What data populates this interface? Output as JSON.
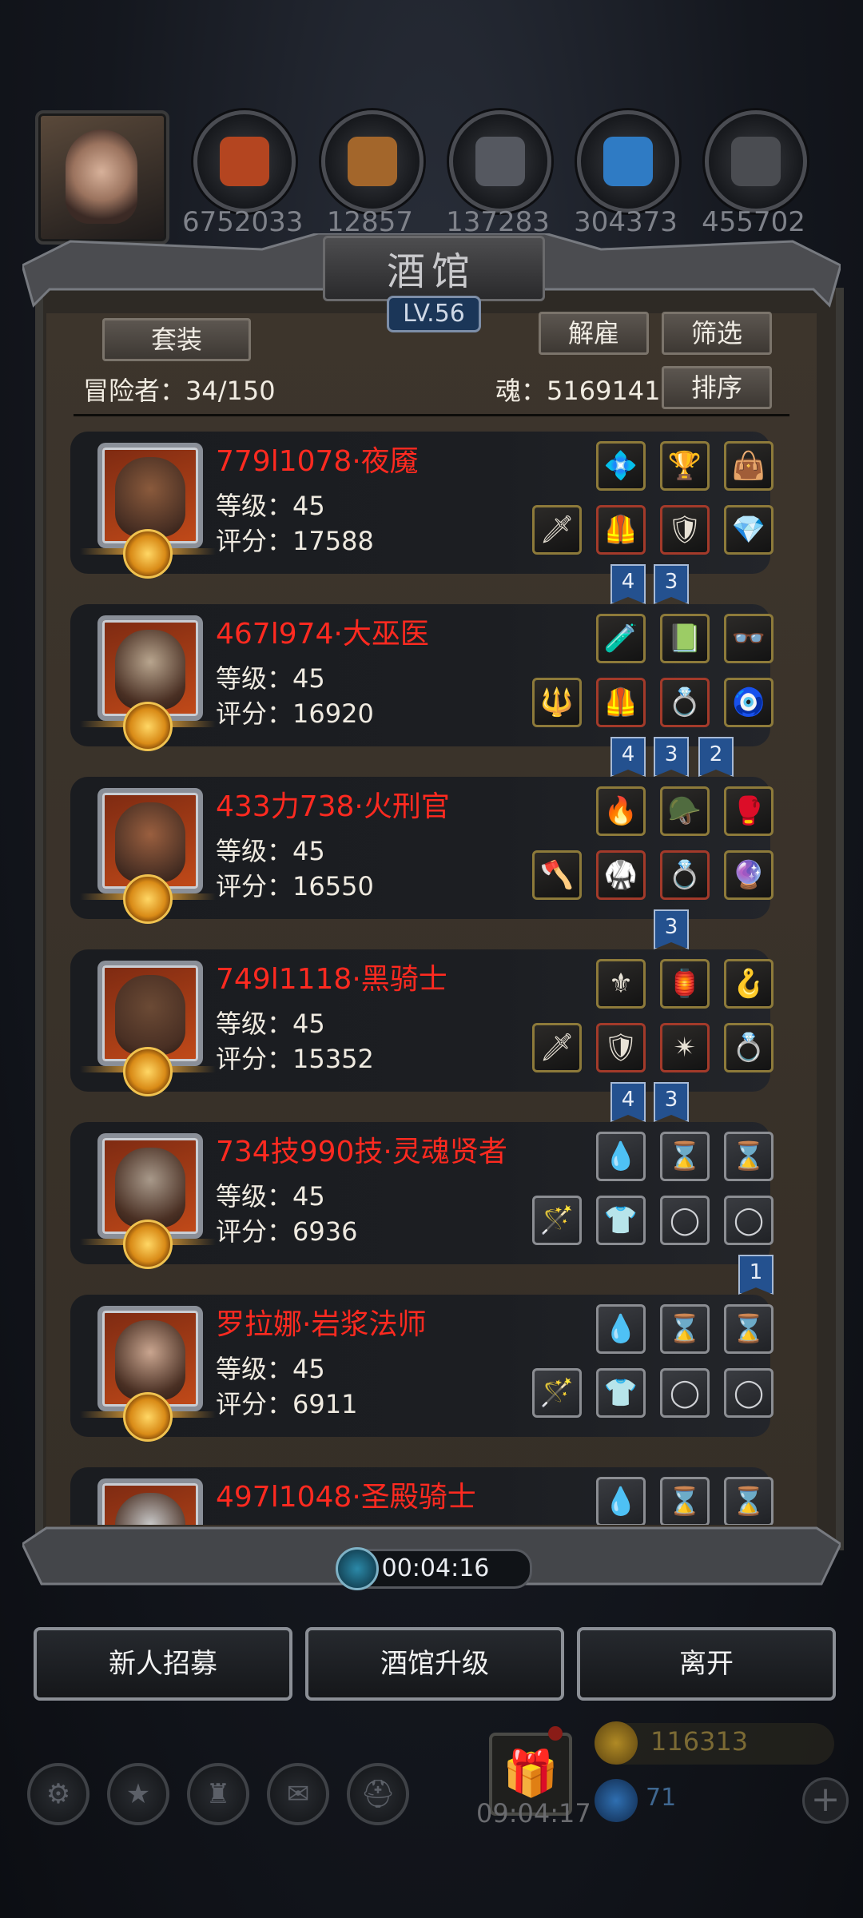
{
  "top_resources": [
    {
      "name": "meat",
      "value": "6752033",
      "color": "#b44520"
    },
    {
      "name": "wood",
      "value": "12857",
      "color": "#a3662b"
    },
    {
      "name": "stone",
      "value": "137283",
      "color": "#555860"
    },
    {
      "name": "crystal",
      "value": "304373",
      "color": "#2f7bc4"
    },
    {
      "name": "iron",
      "value": "455702",
      "color": "#4a4c51"
    }
  ],
  "panel": {
    "title": "酒馆",
    "level": "LV.56",
    "set_button": "套装",
    "dismiss_button": "解雇",
    "filter_button": "筛选",
    "sort_button": "排序",
    "adventurers_label": "冒险者：34/150",
    "soul_label": "魂：5169141"
  },
  "heroes": [
    {
      "name": "779l1078·夜魇",
      "level": "等级：45",
      "score": "评分：17588",
      "face": "#8a5a3c",
      "gear": [
        "💠",
        "🏆",
        "👜",
        "🗡",
        "🦺",
        "🛡",
        "💎"
      ],
      "empty": false,
      "flags": [
        "4",
        "3"
      ]
    },
    {
      "name": "467l974·大巫医",
      "level": "等级：45",
      "score": "评分：16920",
      "face": "#b8a58e",
      "gear": [
        "🧪",
        "📗",
        "👓",
        "🔱",
        "🦺",
        "💍",
        "🧿"
      ],
      "empty": false,
      "flags": [
        "4",
        "3",
        "2"
      ]
    },
    {
      "name": "433力738·火刑官",
      "level": "等级：45",
      "score": "评分：16550",
      "face": "#9a5f3f",
      "gear": [
        "🔥",
        "🪖",
        "🥊",
        "🪓",
        "🥋",
        "💍",
        "🔮"
      ],
      "empty": false,
      "flags": [
        "3"
      ]
    },
    {
      "name": "749l1118·黑骑士",
      "level": "等级：45",
      "score": "评分：15352",
      "face": "#6b4a35",
      "gear": [
        "⚜",
        "🏮",
        "🪝",
        "🗡",
        "🛡",
        "✴",
        "💍"
      ],
      "empty": false,
      "flags": [
        "4",
        "3"
      ]
    },
    {
      "name": "734技990技·灵魂贤者",
      "level": "等级：45",
      "score": "评分：6936",
      "face": "#a8998a",
      "gear": [
        "💧",
        "⌛",
        "⌛",
        "🪄",
        "👕",
        "◯",
        "◯"
      ],
      "empty": true,
      "flags": [
        "1"
      ]
    },
    {
      "name": "罗拉娜·岩浆法师",
      "level": "等级：45",
      "score": "评分：6911",
      "face": "#c9a58f",
      "gear": [
        "💧",
        "⌛",
        "⌛",
        "🪄",
        "👕",
        "◯",
        "◯"
      ],
      "empty": true,
      "flags": []
    },
    {
      "name": "497l1048·圣殿骑士",
      "level": "",
      "score": "",
      "face": "#c8c8c8",
      "gear": [
        "💧",
        "⌛",
        "⌛"
      ],
      "empty": true,
      "flags": []
    }
  ],
  "timer": "00:04:16",
  "bottom_buttons": {
    "recruit": "新人招募",
    "upgrade": "酒馆升级",
    "leave": "离开"
  },
  "footer": {
    "gift_timer": "09:04:17",
    "gold": "116313",
    "gems": "71"
  }
}
